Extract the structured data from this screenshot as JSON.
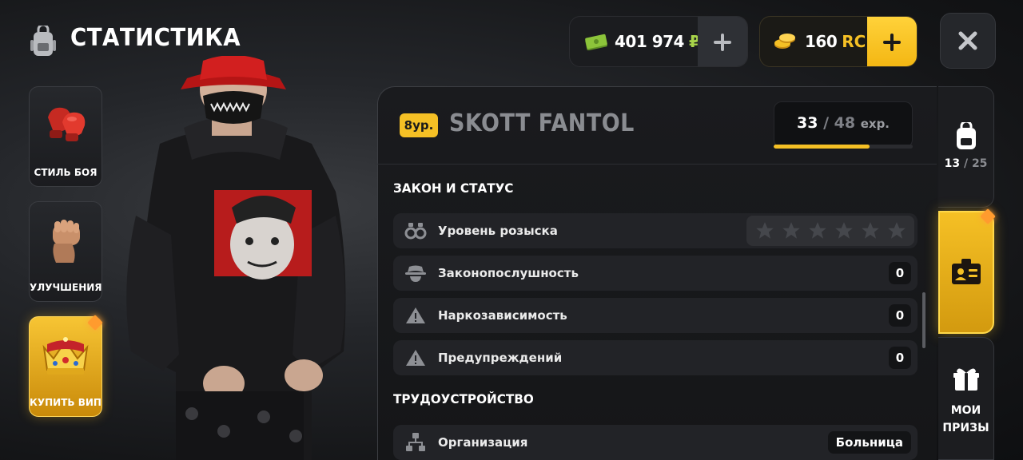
{
  "header": {
    "title": "СТАТИСТИКА",
    "icon": "backpack-icon"
  },
  "currency": {
    "money_value": "401 974",
    "money_symbol": "₽",
    "coins_value": "160",
    "coins_symbol": "RC"
  },
  "sidebar": {
    "items": [
      {
        "label": "СТИЛЬ БОЯ",
        "icon": "boxing-gloves-icon"
      },
      {
        "label": "УЛУЧШЕНИЯ",
        "icon": "fist-icon"
      },
      {
        "label": "КУПИТЬ ВИП",
        "icon": "crown-icon"
      }
    ]
  },
  "player": {
    "level_badge": "8ур.",
    "name": "SKOTT FANTOL",
    "exp_current": "33",
    "exp_separator": "/",
    "exp_max": "48",
    "exp_unit": "ехр.",
    "exp_progress": 0.6875
  },
  "sections": {
    "law_title": "ЗАКОН И СТАТУС",
    "job_title": "ТРУДОУСТРОЙСТВО"
  },
  "rows": {
    "wanted_label": "Уровень розыска",
    "wanted_stars_filled": 0,
    "wanted_stars_total": 6,
    "lawful_label": "Законопослушность",
    "lawful_value": "0",
    "addiction_label": "Наркозависимость",
    "addiction_value": "0",
    "warnings_label": "Предупреждений",
    "warnings_value": "0",
    "org_label": "Организация",
    "org_value": "Больница"
  },
  "right_tabs": {
    "inventory_current": "13",
    "inventory_separator": "/",
    "inventory_max": "25",
    "prizes_line1": "МОИ",
    "prizes_line2": "ПРИЗЫ"
  },
  "colors": {
    "accent": "#f5c025",
    "money_green": "#a8d44a"
  }
}
